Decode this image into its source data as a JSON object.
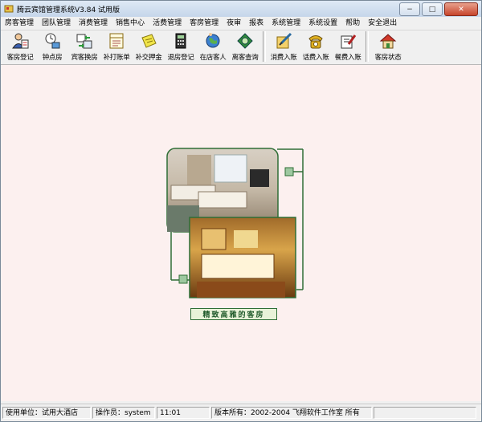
{
  "window": {
    "title": "腾云宾馆管理系统V3.84 试用版"
  },
  "window_controls": {
    "minimize": "−",
    "maximize": "□",
    "close": "✕"
  },
  "menu": [
    "房客管理",
    "团队管理",
    "消费管理",
    "销售中心",
    "活费管理",
    "客房管理",
    "夜审",
    "报表",
    "系统管理",
    "系统设置",
    "帮助",
    "安全退出"
  ],
  "toolbar": {
    "group1": [
      {
        "label": "客房登记",
        "icon": "person-register-icon"
      },
      {
        "label": "钟点房",
        "icon": "clock-room-icon"
      },
      {
        "label": "宾客换房",
        "icon": "swap-room-icon"
      },
      {
        "label": "补打账单",
        "icon": "reprint-bill-icon"
      },
      {
        "label": "补交押金",
        "icon": "deposit-note-icon"
      },
      {
        "label": "退房登记",
        "icon": "checkout-calculator-icon"
      },
      {
        "label": "在店客人",
        "icon": "guests-in-house-icon"
      },
      {
        "label": "离客查询",
        "icon": "departed-query-icon"
      }
    ],
    "group2": [
      {
        "label": "消费入账",
        "icon": "consumption-entry-icon"
      },
      {
        "label": "话费入账",
        "icon": "telephone-entry-icon"
      },
      {
        "label": "餐费入账",
        "icon": "meal-entry-icon"
      }
    ],
    "group3": [
      {
        "label": "客房状态",
        "icon": "room-status-house-icon"
      }
    ]
  },
  "banner": {
    "caption": "精致高雅的客房"
  },
  "status": {
    "unit": "使用单位：试用大酒店",
    "operator": "操作员：system",
    "time": "11:01",
    "copyright": "版本所有：2002-2004  飞翔软件工作室 所有"
  },
  "colors": {
    "main_bg": "#fcf0ef",
    "frame_green": "#2f6e36"
  }
}
